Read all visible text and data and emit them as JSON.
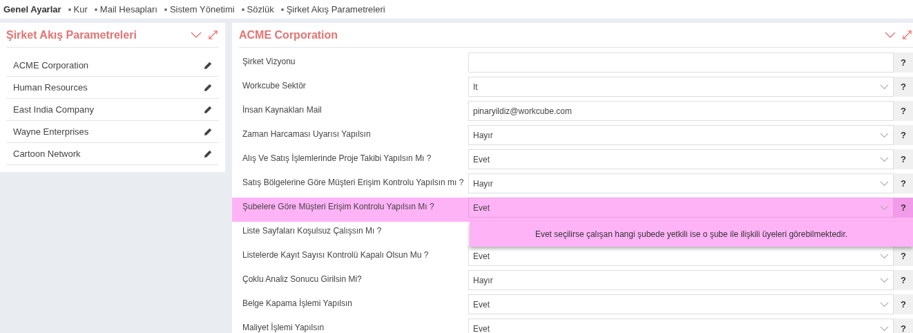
{
  "breadcrumb": [
    {
      "label": "Genel Ayarlar",
      "selected": true
    },
    {
      "label": "Kur",
      "selected": false
    },
    {
      "label": "Mail Hesapları",
      "selected": false
    },
    {
      "label": "Sistem Yönetimi",
      "selected": false
    },
    {
      "label": "Sözlük",
      "selected": false
    },
    {
      "label": "Şirket Akış Parametreleri",
      "selected": false
    }
  ],
  "sidebar": {
    "title": "Şirket Akış Parametreleri",
    "items": [
      {
        "label": "ACME Corporation"
      },
      {
        "label": "Human Resources"
      },
      {
        "label": "East India Company"
      },
      {
        "label": "Wayne Enterprises"
      },
      {
        "label": "Cartoon Network"
      }
    ]
  },
  "form": {
    "title": "ACME Corporation",
    "rows": [
      {
        "label": "Şirket Vizyonu",
        "kind": "text",
        "value": "",
        "highlighted": false
      },
      {
        "label": "Workcube Sektör",
        "kind": "select",
        "value": "It",
        "highlighted": false
      },
      {
        "label": "İnsan Kaynakları Mail",
        "kind": "text",
        "value": "pinaryildiz@workcube.com",
        "highlighted": false
      },
      {
        "label": "Zaman Harcaması Uyarısı Yapılsın",
        "kind": "select",
        "value": "Hayır",
        "highlighted": false
      },
      {
        "label": "Alış Ve Satış İşlemlerinde Proje Takibi Yapılsın Mı ?",
        "kind": "select",
        "value": "Evet",
        "highlighted": false
      },
      {
        "label": "Satış Bölgelerine Göre Müşteri Erişim Kontrolu Yapılsın mı ?",
        "kind": "select",
        "value": "Hayır",
        "highlighted": false
      },
      {
        "label": "Şubelere Göre Müşteri Erişim Kontrolu Yapılsın Mı ?",
        "kind": "select",
        "value": "Evet",
        "highlighted": true,
        "hint": "Evet seçilirse çalışan hangi şubede yetkili ise o şube ile ilişkili üyeleri görebilmektedir."
      },
      {
        "label": "Liste Sayfaları Koşulsuz Çalışsın Mı ?",
        "kind": "hidden",
        "highlighted": false
      },
      {
        "label": "Listelerde Kayıt Sayısı Kontrolü Kapalı Olsun Mu ?",
        "kind": "select",
        "value": "Evet",
        "highlighted": false
      },
      {
        "label": "Çoklu Analiz Sonucu Girilsin Mi?",
        "kind": "select",
        "value": "Hayır",
        "highlighted": false
      },
      {
        "label": "Belge Kapama İşlemi Yapılsın",
        "kind": "select",
        "value": "Evet",
        "highlighted": false
      },
      {
        "label": "Maliyet İşlemi Yapılsın",
        "kind": "select",
        "value": "Evet",
        "highlighted": false
      }
    ],
    "help_label": "?"
  }
}
